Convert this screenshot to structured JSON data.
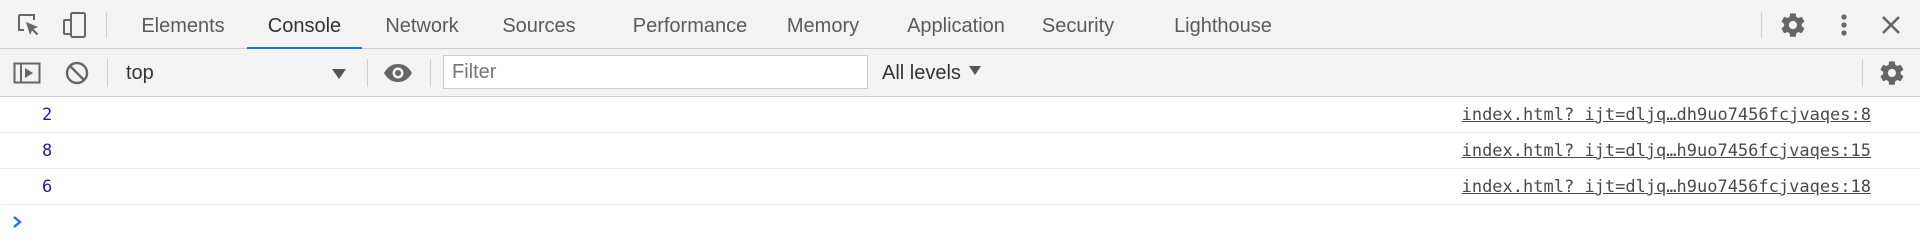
{
  "tabs": [
    {
      "label": "Elements",
      "active": false
    },
    {
      "label": "Console",
      "active": true
    },
    {
      "label": "Network",
      "active": false
    },
    {
      "label": "Sources",
      "active": false
    },
    {
      "label": "Performance",
      "active": false
    },
    {
      "label": "Memory",
      "active": false
    },
    {
      "label": "Application",
      "active": false
    },
    {
      "label": "Security",
      "active": false
    },
    {
      "label": "Lighthouse",
      "active": false
    }
  ],
  "tabbar_icons": {
    "inspect": "inspect-element-icon",
    "device": "device-toolbar-icon",
    "settings": "gear-icon",
    "more": "more-vertical-icon",
    "close": "close-icon"
  },
  "toolbar": {
    "context": "top",
    "filter_placeholder": "Filter",
    "filter_value": "",
    "levels": "All levels"
  },
  "toolbar_icons": {
    "sidebar": "sidebar-toggle-icon",
    "clear": "clear-console-icon",
    "live_expression": "eye-icon",
    "settings": "gear-icon"
  },
  "messages": [
    {
      "value": "2",
      "source": "index.html? ijt=dljq…dh9uo7456fcjvaqes:8"
    },
    {
      "value": "8",
      "source": "index.html? ijt=dljq…h9uo7456fcjvaqes:15"
    },
    {
      "value": "6",
      "source": "index.html? ijt=dljq…h9uo7456fcjvaqes:18"
    }
  ],
  "colors": {
    "accent": "#1a73e8",
    "number": "#1a1aa6",
    "toolbar_bg": "#f3f3f3"
  }
}
